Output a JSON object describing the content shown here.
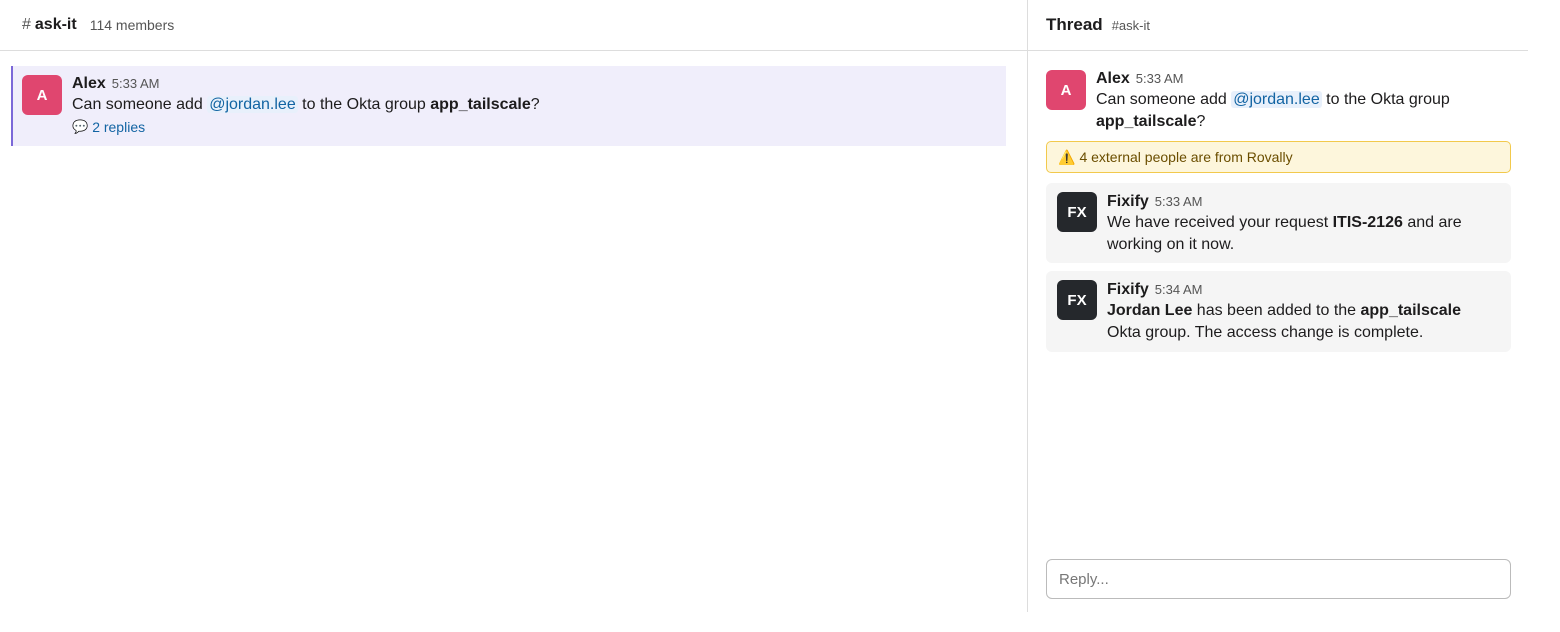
{
  "channel": {
    "hash": "#",
    "name": "ask-it",
    "member_count": "114 members"
  },
  "main_message": {
    "avatar_letter": "A",
    "author": "Alex",
    "time": "5:33 AM",
    "text_before": "Can someone add ",
    "mention": "@jordan.lee",
    "text_middle": " to the Okta group ",
    "group": "app_tailscale",
    "text_after": "?",
    "replies_icon": "💬",
    "replies_label": "2 replies"
  },
  "thread": {
    "title": "Thread",
    "channel": "#ask-it",
    "root": {
      "avatar_letter": "A",
      "author": "Alex",
      "time": "5:33 AM",
      "text_before": "Can someone add ",
      "mention": "@jordan.lee",
      "text_middle": " to the Okta group ",
      "group": "app_tailscale",
      "text_after": "?"
    },
    "external_banner": {
      "icon": "⚠️",
      "text": "4 external people are from Rovally"
    },
    "replies": [
      {
        "avatar_letters": "FX",
        "author": "Fixify",
        "time": "5:33 AM",
        "text_before": "We have received your request ",
        "bold": "ITIS-2126",
        "text_after": " and are working on it now."
      },
      {
        "avatar_letters": "FX",
        "author": "Fixify",
        "time": "5:34 AM",
        "bold_name": "Jordan Lee",
        "text_middle": " has been added to the ",
        "bold_group": "app_tailscale",
        "text_after": " Okta group. The access change is complete."
      }
    ],
    "reply_placeholder": "Reply..."
  },
  "colors": {
    "alex_avatar": "#e0466f",
    "bot_avatar": "#25282c",
    "highlight_bg": "#f0eefb",
    "highlight_border": "#7b68d8",
    "link": "#1264a3",
    "warning_bg": "#fdf6dc",
    "warning_border": "#f2c94c"
  }
}
